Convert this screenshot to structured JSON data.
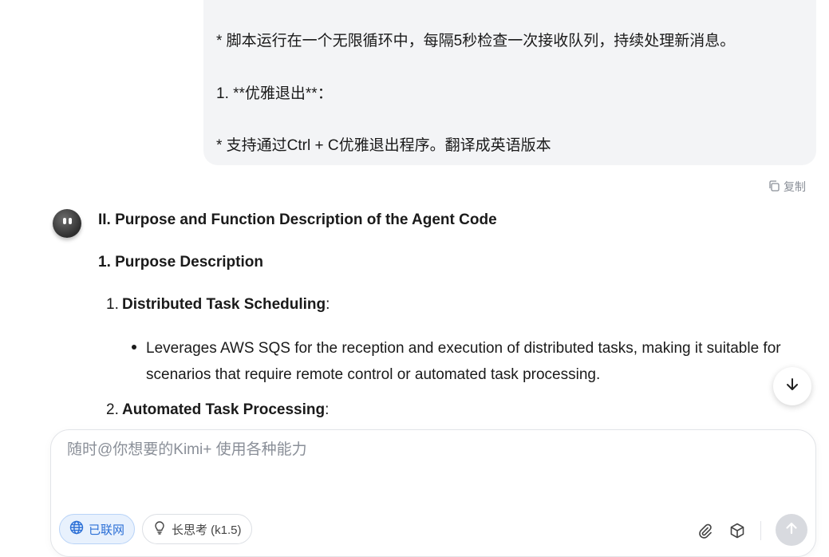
{
  "user_message": {
    "lines": [
      "* 脚本运行在一个无限循环中，每隔5秒检查一次接收队列，持续处理新消息。",
      "1. **优雅退出**：",
      "* 支持通过Ctrl + C优雅退出程序。翻译成英语版本"
    ]
  },
  "copy_label": "复制",
  "assistant": {
    "title": "II. Purpose and Function Description of the Agent Code",
    "subtitle": "1. Purpose Description",
    "items": [
      {
        "num": "1.",
        "heading": "Distributed Task Scheduling",
        "suffix": ":"
      },
      {
        "num": "2.",
        "heading": "Automated Task Processing",
        "suffix": ":"
      }
    ],
    "bullet": "Leverages AWS SQS for the reception and execution of distributed tasks, making it suitable for scenarios that require remote control or automated task processing."
  },
  "composer": {
    "placeholder": "随时@你想要的Kimi+ 使用各种能力",
    "online_label": "已联网",
    "think_label": "长思考 (k1.5)"
  },
  "icons": {
    "copy": "copy-icon",
    "scroll": "arrow-down-icon",
    "globe": "globe-icon",
    "bulb": "lightbulb-icon",
    "attach": "paperclip-icon",
    "cube": "cube-icon",
    "send": "arrow-up-icon"
  },
  "colors": {
    "accent": "#2b6fd6",
    "bubble": "#f3f4f6",
    "send_disabled": "#d8dadf"
  }
}
